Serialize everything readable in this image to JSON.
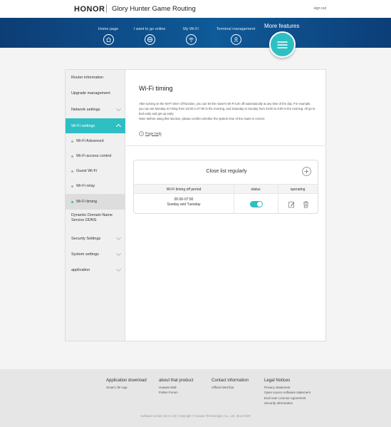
{
  "header": {
    "logo": "HONOR",
    "product": "Glory Hunter Game Routing",
    "signout": "sign out"
  },
  "nav": {
    "items": [
      {
        "label": "Home page",
        "icon": "home-icon"
      },
      {
        "label": "I want to go online",
        "icon": "globe-icon"
      },
      {
        "label": "My Wi-Fi",
        "icon": "wifi-icon"
      },
      {
        "label": "Terminal management",
        "icon": "user-icon"
      }
    ],
    "more": "More features",
    "menu_icon": "menu-icon",
    "accent": "#2ebfc3"
  },
  "sidebar": {
    "items": [
      {
        "label": "Router information"
      },
      {
        "label": "Upgrade management"
      },
      {
        "label": "Network settings"
      },
      {
        "label": "Wi-Fi settings"
      },
      {
        "label": "Wi-Fi Advanced"
      },
      {
        "label": "Wi-Fi access control"
      },
      {
        "label": "Guest Wi-Fi"
      },
      {
        "label": "Wi-Fi relay"
      },
      {
        "label": "Wi-Fi timing"
      },
      {
        "label": "Dynamic Domain Name Service DDNS"
      },
      {
        "label": "Security Settings"
      },
      {
        "label": "System settings"
      },
      {
        "label": "application"
      }
    ]
  },
  "content": {
    "title": "Wi-Fi timing",
    "description": "After turning on the Wi-Fi timer off function, you can let the router's Wi-Fi turn off automatically at any time of the day. For example, you can set Monday to Friday from 22:00 to 07:00 in the morning, and Saturday to Sunday from 23:00 to 8:00 in the morning. All go to bed early and get up early.",
    "note": "Note: Before using this function, please confirm whether the system time of the router is correct.",
    "help": "Page help"
  },
  "card": {
    "title": "Close list regularly",
    "columns": [
      "Wi-Fi timing off period",
      "status",
      "operating"
    ],
    "rows": [
      {
        "time": "00:00-07:00",
        "days": "Sunday and Tuesday",
        "status": "on"
      }
    ]
  },
  "footer": {
    "cols": [
      {
        "title": "Application download",
        "links": [
          "Smart Life App"
        ]
      },
      {
        "title": "about that product",
        "links": [
          "Huawei Mall",
          "Pollen Forum"
        ]
      },
      {
        "title": "Contact information",
        "links": [
          "Official WeChat"
        ]
      },
      {
        "title": "Legal Notices",
        "links": [
          "Privacy Statement",
          "Open source software statement",
          "End User License Agreement",
          "Security Information"
        ]
      }
    ],
    "copyright": "Software version:10.0.2.33 | Copyright © Huawei Technologies Co., Ltd. 2012-2020"
  }
}
